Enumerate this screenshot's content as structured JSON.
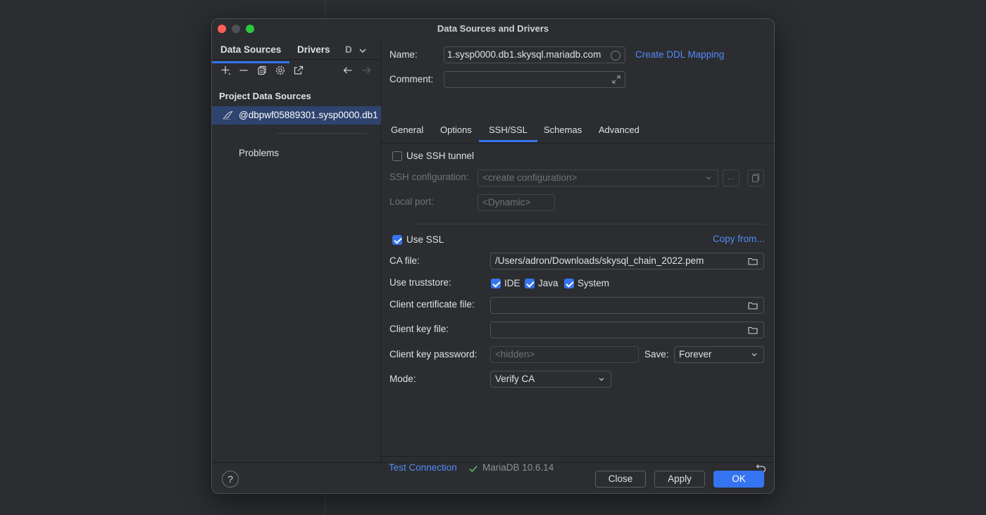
{
  "window": {
    "title": "Data Sources and Drivers"
  },
  "left": {
    "tabs": [
      {
        "label": "Data Sources"
      },
      {
        "label": "Drivers"
      },
      {
        "label": "D"
      }
    ],
    "section_title": "Project Data Sources",
    "selected_datasource": "@dbpwf05889301.sysp0000.db1",
    "problems_label": "Problems"
  },
  "form": {
    "name_label": "Name:",
    "name_value": "1.sysp0000.db1.skysql.mariadb.com",
    "create_ddl_link": "Create DDL Mapping",
    "comment_label": "Comment:",
    "comment_value": ""
  },
  "tabs": [
    {
      "label": "General"
    },
    {
      "label": "Options"
    },
    {
      "label": "SSH/SSL"
    },
    {
      "label": "Schemas"
    },
    {
      "label": "Advanced"
    }
  ],
  "ssh": {
    "use_tunnel_label": "Use SSH tunnel",
    "use_tunnel_checked": false,
    "config_label": "SSH configuration:",
    "config_value": "<create configuration>",
    "more_label": "...",
    "local_port_label": "Local port:",
    "local_port_placeholder": "<Dynamic>"
  },
  "ssl": {
    "use_ssl_label": "Use SSL",
    "use_ssl_checked": true,
    "copy_from_link": "Copy from...",
    "ca_file_label": "CA file:",
    "ca_file_value": "/Users/adron/Downloads/skysql_chain_2022.pem",
    "truststore_label": "Use truststore:",
    "truststore": [
      {
        "label": "IDE",
        "checked": true
      },
      {
        "label": "Java",
        "checked": true
      },
      {
        "label": "System",
        "checked": true
      }
    ],
    "client_cert_label": "Client certificate file:",
    "client_cert_value": "",
    "client_key_label": "Client key file:",
    "client_key_value": "",
    "client_key_password_label": "Client key password:",
    "client_key_password_placeholder": "<hidden>",
    "save_label": "Save:",
    "save_value": "Forever",
    "mode_label": "Mode:",
    "mode_value": "Verify CA"
  },
  "status": {
    "test_connection_link": "Test Connection",
    "server_version": "MariaDB 10.6.14"
  },
  "buttons": {
    "help": "?",
    "close": "Close",
    "apply": "Apply",
    "ok": "OK"
  },
  "colors": {
    "accent": "#3574f0",
    "link": "#548af7",
    "success": "#5fb865"
  }
}
